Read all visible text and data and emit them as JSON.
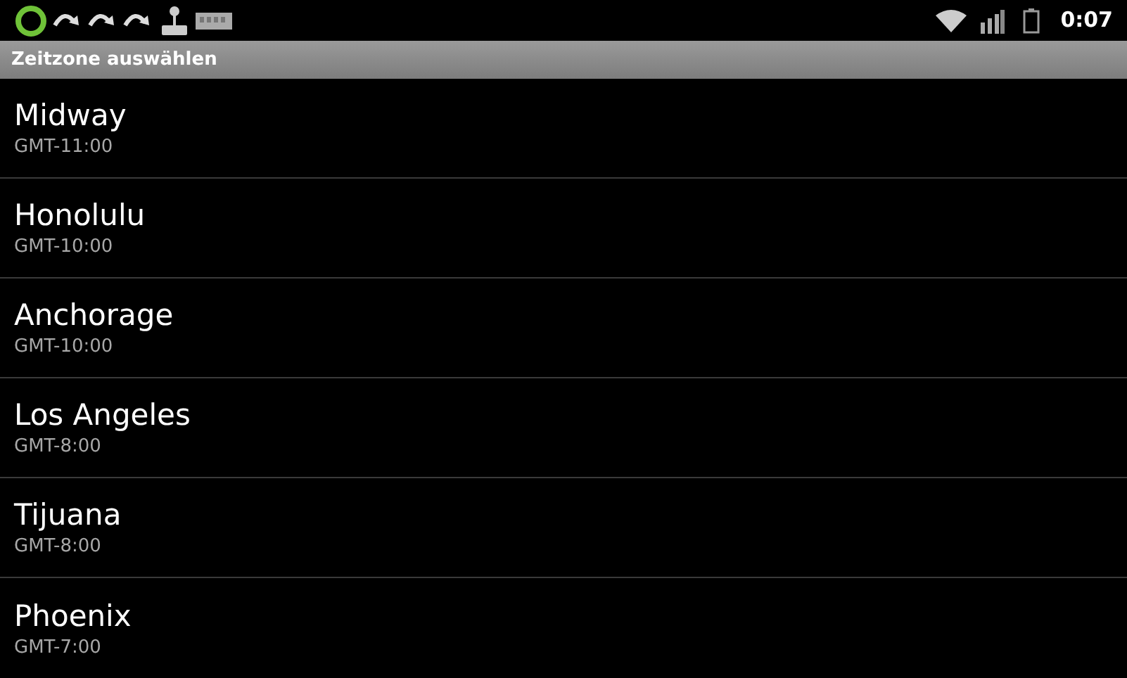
{
  "status_bar": {
    "time": "0:07"
  },
  "title": "Zeitzone auswählen",
  "timezones": [
    {
      "name": "Midway",
      "offset": "GMT-11:00"
    },
    {
      "name": "Honolulu",
      "offset": "GMT-10:00"
    },
    {
      "name": "Anchorage",
      "offset": "GMT-10:00"
    },
    {
      "name": "Los Angeles",
      "offset": "GMT-8:00"
    },
    {
      "name": "Tijuana",
      "offset": "GMT-8:00"
    },
    {
      "name": "Phoenix",
      "offset": "GMT-7:00"
    }
  ]
}
